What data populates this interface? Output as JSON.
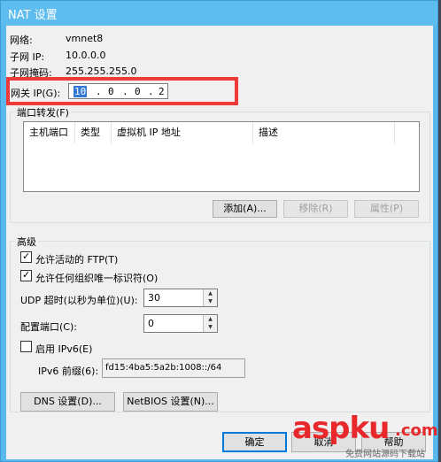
{
  "window": {
    "title": "NAT 设置"
  },
  "info": {
    "network_label": "网络:",
    "network_value": "vmnet8",
    "subnet_ip_label": "子网 IP:",
    "subnet_ip_value": "10.0.0.0",
    "subnet_mask_label": "子网掩码:",
    "subnet_mask_value": "255.255.255.0"
  },
  "gateway": {
    "label": "网关 IP(G):",
    "octets": [
      "10",
      "0",
      "0",
      "2"
    ],
    "dot": "."
  },
  "port_forwarding": {
    "group_title": "端口转发(F)",
    "columns": [
      "主机端口",
      "类型",
      "虚拟机 IP 地址",
      "描述"
    ],
    "add_button": "添加(A)...",
    "remove_button": "移除(R)",
    "properties_button": "属性(P)"
  },
  "advanced": {
    "group_title": "高级",
    "allow_ftp_label": "允许活动的 FTP(T)",
    "allow_ftp_checked": true,
    "allow_any_oui_label": "允许任何组织唯一标识符(O)",
    "allow_any_oui_checked": true,
    "udp_timeout_label": "UDP 超时(以秒为单位)(U):",
    "udp_timeout_value": "30",
    "config_port_label": "配置端口(C):",
    "config_port_value": "0",
    "enable_ipv6_label": "启用 IPv6(E)",
    "enable_ipv6_checked": false,
    "ipv6_prefix_label": "IPv6 前缀(6):",
    "ipv6_prefix_value": "fd15:4ba5:5a2b:1008::/64",
    "dns_button": "DNS 设置(D)...",
    "netbios_button": "NetBIOS 设置(N)..."
  },
  "footer": {
    "ok_button": "确定",
    "cancel_button": "取消",
    "help_button": "帮助"
  },
  "watermark": {
    "brand": "aspku",
    "suffix": ".com",
    "tagline": "免费网站源码下载站"
  },
  "colors": {
    "titlebar": "#5fbcef",
    "highlight_box": "#ef3a3a",
    "selection": "#3478d6",
    "watermark_red": "#e8282b"
  }
}
